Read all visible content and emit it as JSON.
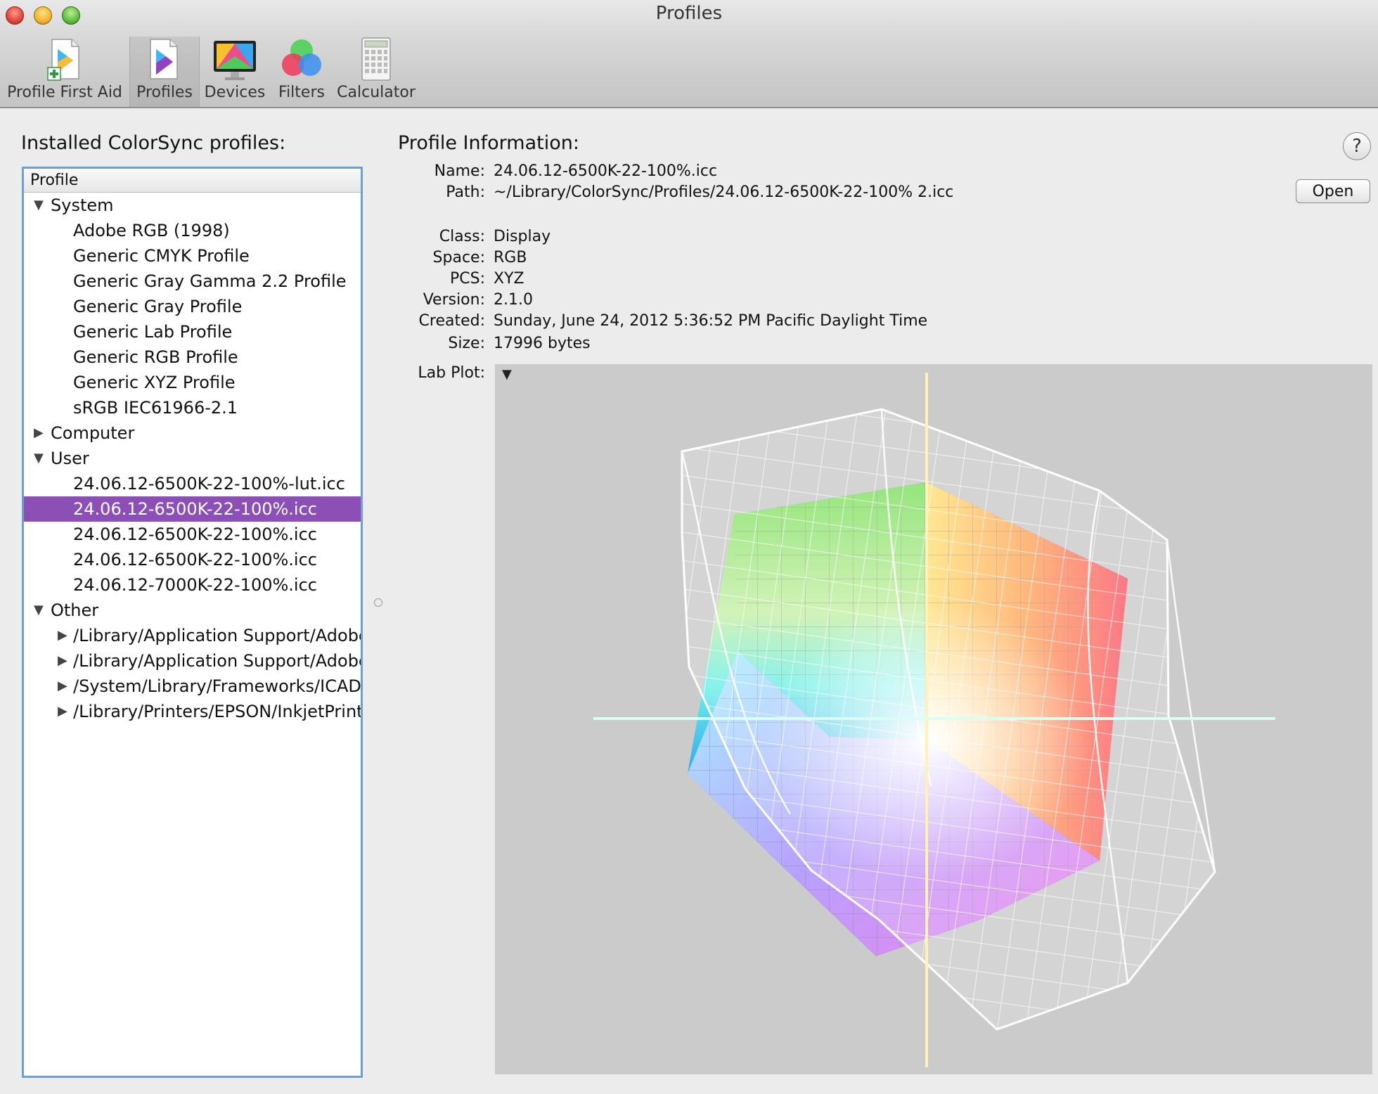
{
  "window": {
    "title": "Profiles"
  },
  "toolbar": {
    "items": [
      {
        "id": "profile-first-aid",
        "label": "Profile First Aid"
      },
      {
        "id": "profiles",
        "label": "Profiles",
        "selected": true
      },
      {
        "id": "devices",
        "label": "Devices"
      },
      {
        "id": "filters",
        "label": "Filters"
      },
      {
        "id": "calculator",
        "label": "Calculator"
      }
    ]
  },
  "profiles_panel": {
    "heading": "Installed ColorSync profiles:",
    "column_header": "Profile",
    "groups": [
      {
        "label": "System",
        "expanded": true,
        "items": [
          "Adobe RGB (1998)",
          "Generic CMYK Profile",
          "Generic Gray Gamma 2.2 Profile",
          "Generic Gray Profile",
          "Generic Lab Profile",
          "Generic RGB Profile",
          "Generic XYZ Profile",
          "sRGB IEC61966-2.1"
        ]
      },
      {
        "label": "Computer",
        "expanded": false,
        "items": []
      },
      {
        "label": "User",
        "expanded": true,
        "items": [
          "24.06.12-6500K-22-100%-lut.icc",
          "24.06.12-6500K-22-100%.icc",
          "24.06.12-6500K-22-100%.icc",
          "24.06.12-6500K-22-100%.icc",
          "24.06.12-7000K-22-100%.icc"
        ],
        "selected_index": 1
      },
      {
        "label": "Other",
        "expanded": true,
        "subfolders": [
          "/Library/Application Support/Adobe",
          "/Library/Application Support/Adobe",
          "/System/Library/Frameworks/ICAD",
          "/Library/Printers/EPSON/InkjetPrint"
        ]
      }
    ]
  },
  "info_panel": {
    "heading": "Profile Information:",
    "help_label": "?",
    "open_label": "Open",
    "fields": {
      "name": {
        "label": "Name:",
        "value": "24.06.12-6500K-22-100%.icc"
      },
      "path": {
        "label": "Path:",
        "value": "~/Library/ColorSync/Profiles/24.06.12-6500K-22-100% 2.icc"
      },
      "class": {
        "label": "Class:",
        "value": "Display"
      },
      "space": {
        "label": "Space:",
        "value": "RGB"
      },
      "pcs": {
        "label": "PCS:",
        "value": "XYZ"
      },
      "version": {
        "label": "Version:",
        "value": "2.1.0"
      },
      "created": {
        "label": "Created:",
        "value": "Sunday, June 24, 2012 5:36:52 PM Pacific Daylight Time"
      },
      "size": {
        "label": "Size:",
        "value": "17996 bytes"
      }
    },
    "lab_plot_label": "Lab Plot:",
    "plot_menu_icon": "triangle-down-icon"
  },
  "colors": {
    "selection": "#8b4fb6",
    "listbox_focus_ring": "#6a9fd8",
    "plot_background": "#cbcbcb"
  }
}
